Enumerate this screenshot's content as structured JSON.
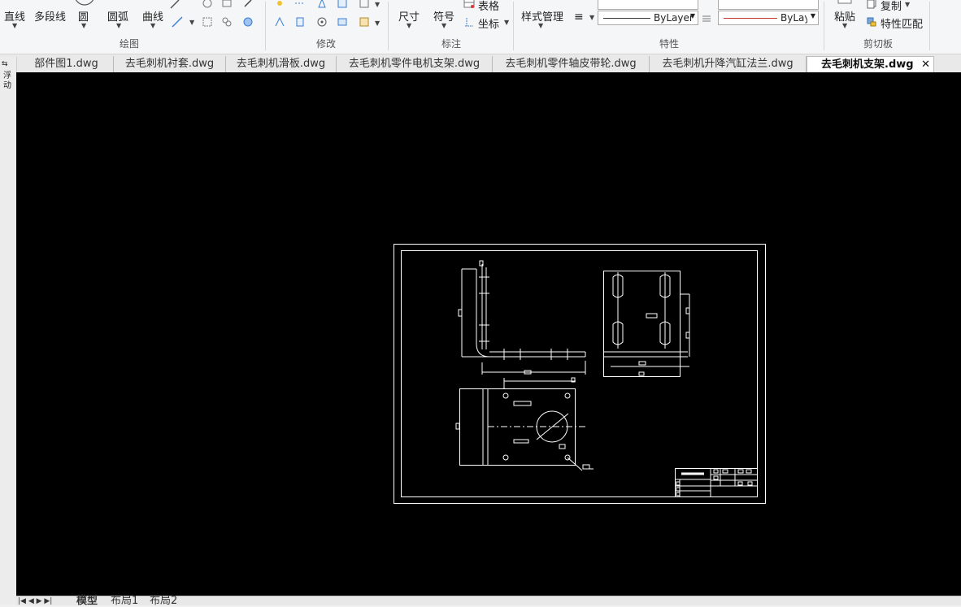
{
  "ribbon": {
    "draw": {
      "line": "直线",
      "polyline": "多段线",
      "circle": "圆",
      "arc": "圆弧",
      "curve": "曲线",
      "group_label": "绘图"
    },
    "modify": {
      "group_label": "修改"
    },
    "annotate": {
      "dimension": "尺寸",
      "symbol": "符号",
      "table": "表格",
      "coordinate": "坐标",
      "group_label": "标注"
    },
    "properties": {
      "style_manager": "样式管理",
      "linetype_value": "ByLayer",
      "color_value": "ByLaye",
      "group_label": "特性"
    },
    "clipboard": {
      "paste": "粘贴",
      "copy": "复制",
      "match_properties": "特性匹配",
      "group_label": "剪切板"
    }
  },
  "tabs": [
    {
      "label": "部件图1.dwg",
      "active": false
    },
    {
      "label": "去毛刺机衬套.dwg",
      "active": false
    },
    {
      "label": "去毛刺机滑板.dwg",
      "active": false
    },
    {
      "label": "去毛刺机零件电机支架.dwg",
      "active": false
    },
    {
      "label": "去毛刺机零件轴皮带轮.dwg",
      "active": false
    },
    {
      "label": "去毛刺机升降汽缸法兰.dwg",
      "active": false
    },
    {
      "label": "去毛刺机支架.dwg",
      "active": true
    }
  ],
  "tab_close_icon": "close-icon",
  "left_strip_labels": [
    "浮",
    "动"
  ],
  "layouts": [
    {
      "label": "模型",
      "active": true
    },
    {
      "label": "布局1",
      "active": false
    },
    {
      "label": "布局2",
      "active": false
    }
  ],
  "colors": {
    "canvas": "#000000",
    "drawing_lines": "#ffffff",
    "color_swatch": "#c0392b"
  }
}
